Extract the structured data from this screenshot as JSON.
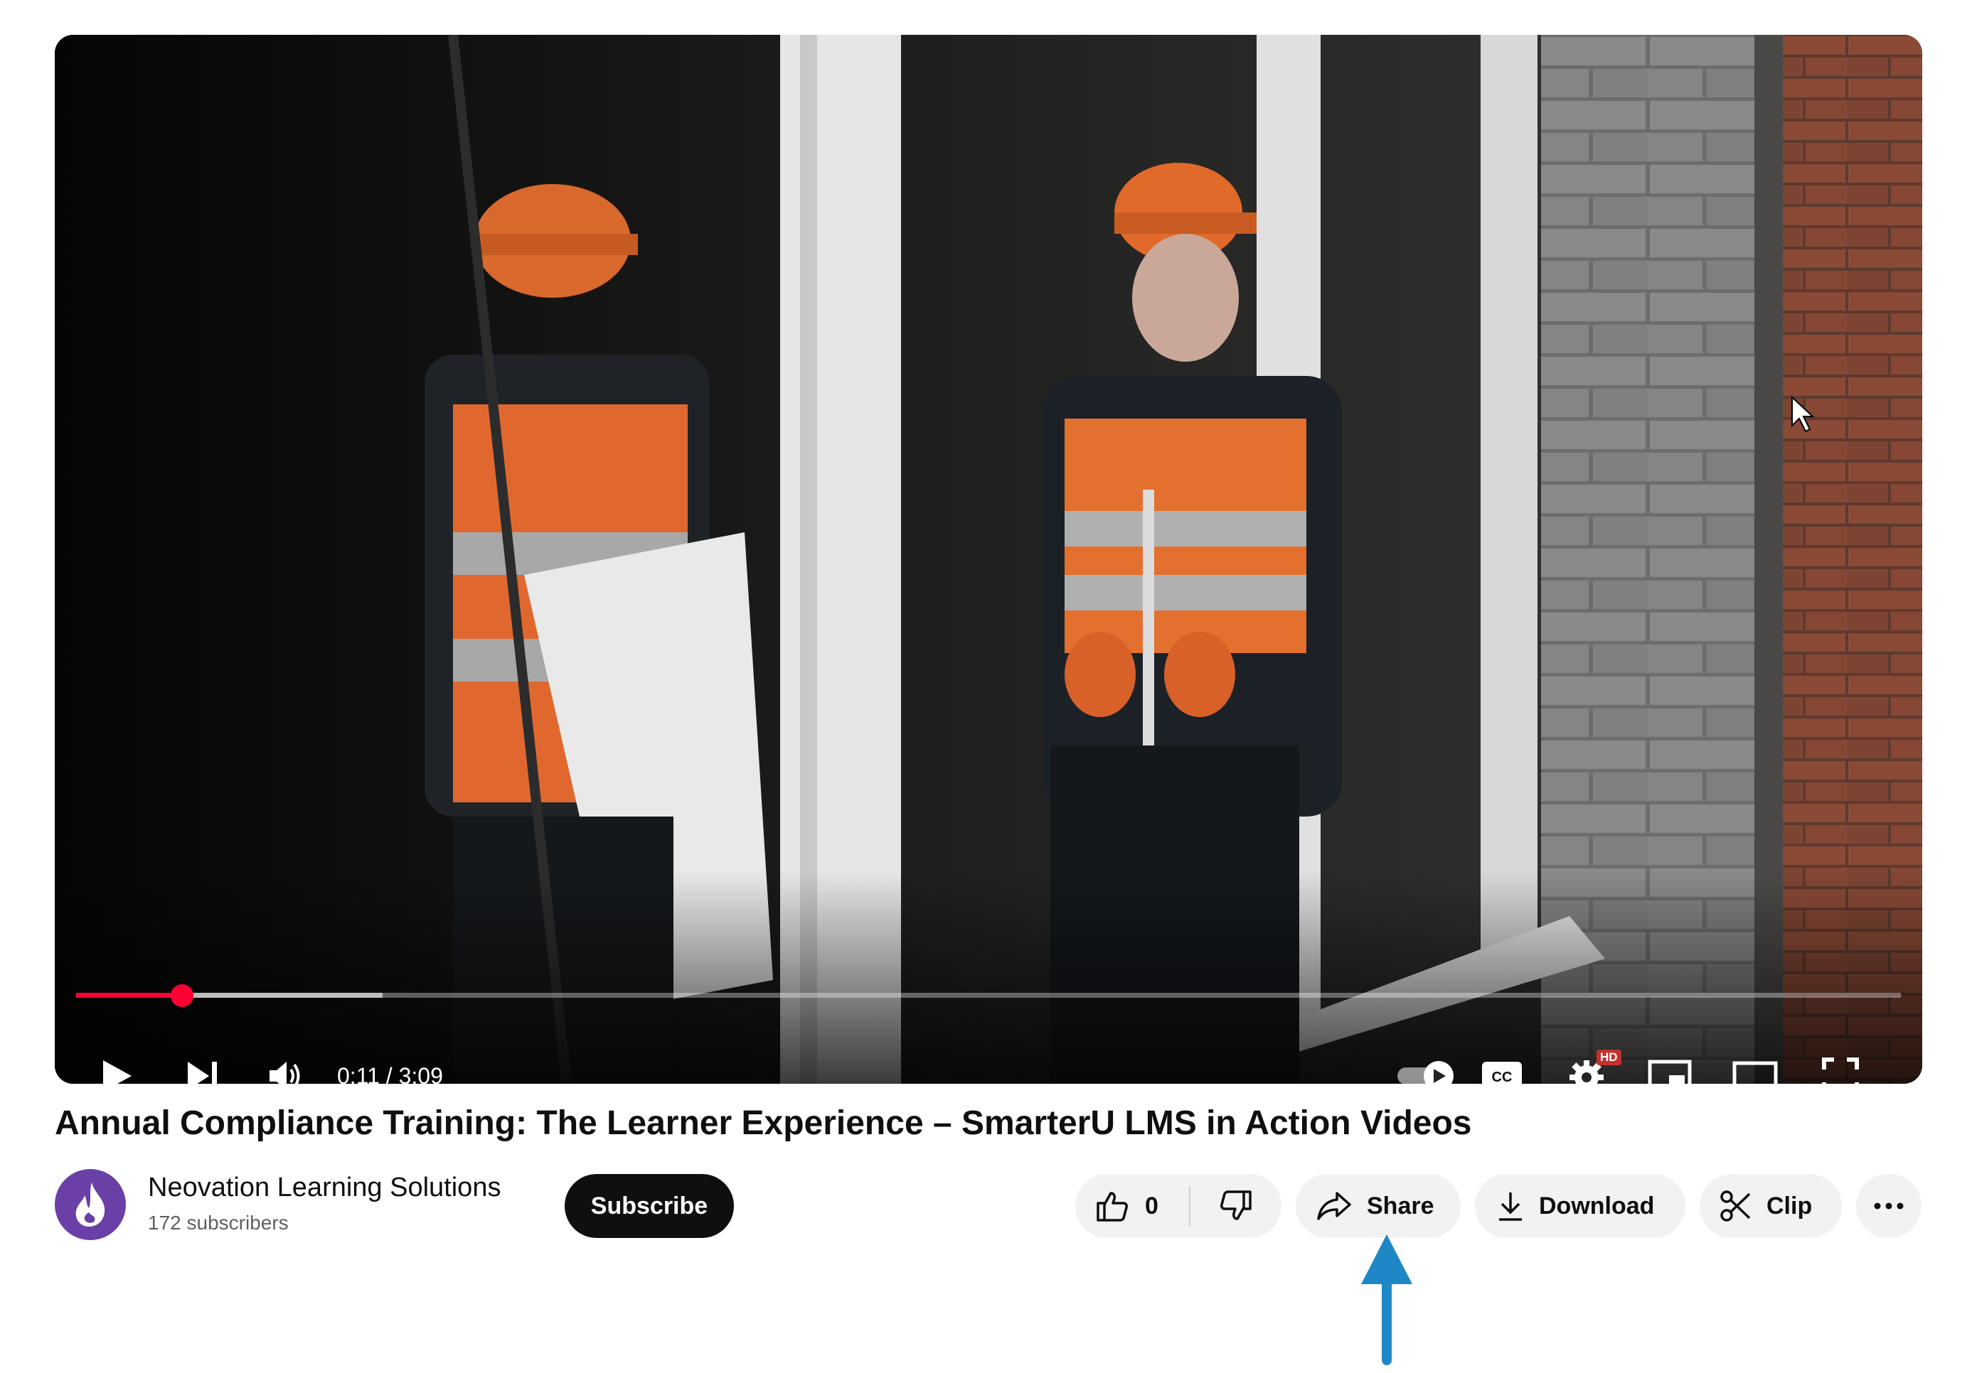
{
  "player": {
    "current_time": "0:11",
    "duration": "3:09",
    "time_display": "0:11 / 3:09",
    "progress_fraction": 0.058,
    "buffered_fraction": 0.168,
    "autoplay": "on",
    "quality_badge": "HD",
    "accent_color": "#ff0033"
  },
  "video": {
    "title": "Annual Compliance Training: The Learner Experience – SmarterU LMS in Action Videos"
  },
  "channel": {
    "name": "Neovation Learning Solutions",
    "subscribers": "172 subscribers",
    "subscribe_label": "Subscribe",
    "avatar_color": "#6a3fa6"
  },
  "actions": {
    "like_count": "0",
    "share_label": "Share",
    "download_label": "Download",
    "clip_label": "Clip"
  },
  "annotation": {
    "arrow_color": "#1e88c7",
    "target": "Share"
  }
}
